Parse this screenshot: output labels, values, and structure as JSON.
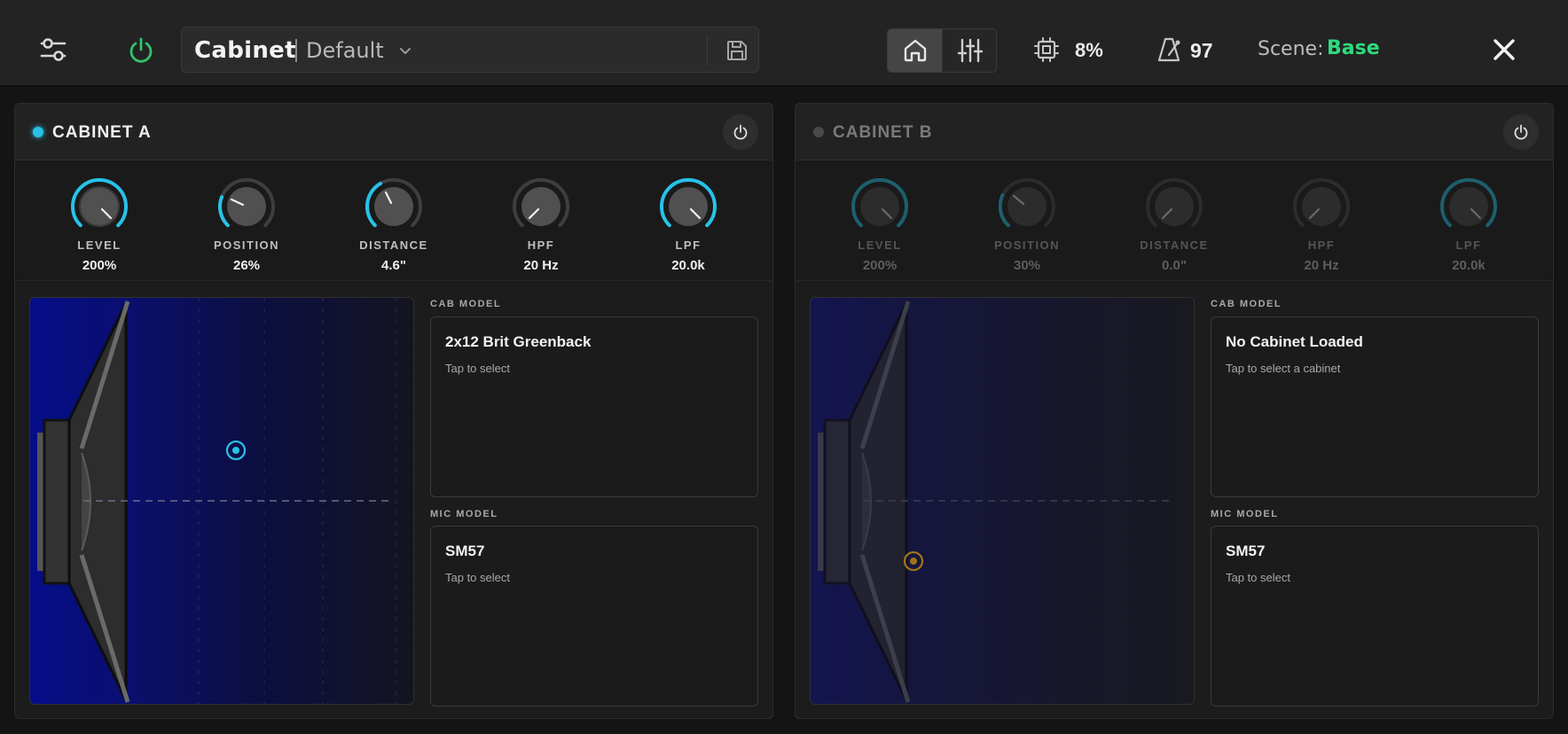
{
  "header": {
    "preset_name": "Cabinet",
    "preset_variant": "Default",
    "cpu_value": "8%",
    "tempo_value": "97",
    "scene_label": "Scene:",
    "scene_value": "Base"
  },
  "colors": {
    "accent": "#27c2e8",
    "power_on": "#34c46b",
    "scene": "#2fdb7d",
    "mic_a": "#27c2e8",
    "mic_b": "#a07416"
  },
  "cabinets": [
    {
      "title": "CABINET A",
      "active": true,
      "knobs": [
        {
          "label": "LEVEL",
          "value": "200%"
        },
        {
          "label": "POSITION",
          "value": "26%"
        },
        {
          "label": "DISTANCE",
          "value": "4.6\""
        },
        {
          "label": "HPF",
          "value": "20 Hz"
        },
        {
          "label": "LPF",
          "value": "20.0k"
        }
      ],
      "cab_label": "CAB MODEL",
      "cab_name": "2x12 Brit Greenback",
      "cab_hint": "Tap to select",
      "mic_label": "MIC MODEL",
      "mic_name": "SM57",
      "mic_hint": "Tap to select"
    },
    {
      "title": "CABINET B",
      "active": false,
      "knobs": [
        {
          "label": "LEVEL",
          "value": "200%"
        },
        {
          "label": "POSITION",
          "value": "30%"
        },
        {
          "label": "DISTANCE",
          "value": "0.0\""
        },
        {
          "label": "HPF",
          "value": "20 Hz"
        },
        {
          "label": "LPF",
          "value": "20.0k"
        }
      ],
      "cab_label": "CAB MODEL",
      "cab_name": "No Cabinet Loaded",
      "cab_hint": "Tap to select a cabinet",
      "mic_label": "MIC MODEL",
      "mic_name": "SM57",
      "mic_hint": "Tap to select"
    }
  ]
}
